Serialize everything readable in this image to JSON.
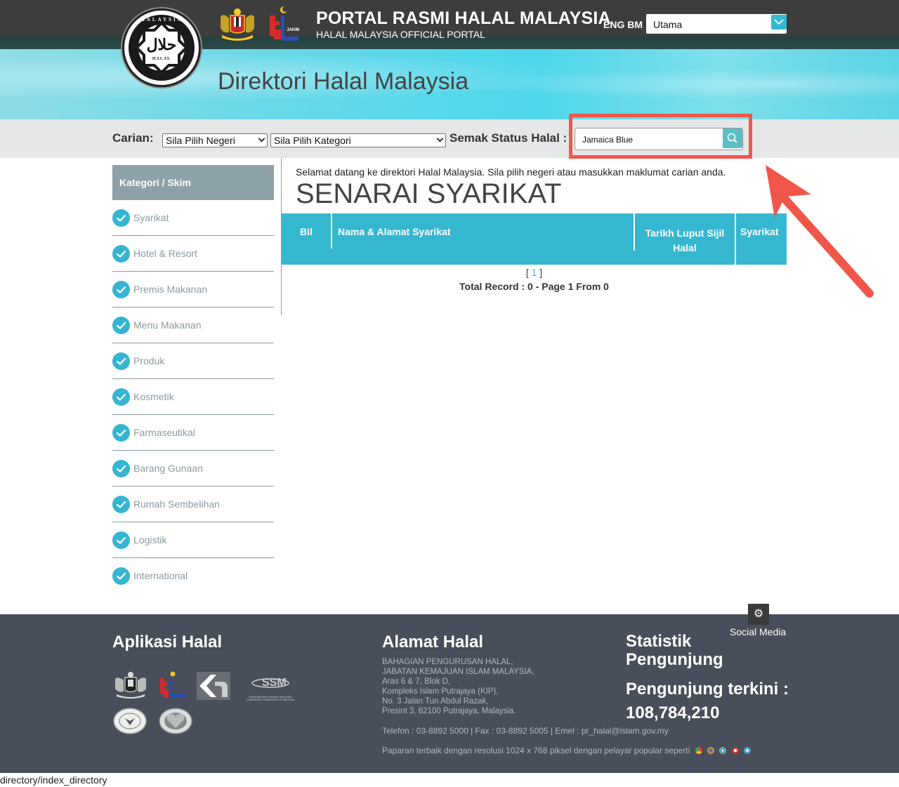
{
  "header": {
    "portal_title": "PORTAL RASMI HALAL MALAYSIA",
    "portal_subtitle": "HALAL MALAYSIA OFFICIAL PORTAL",
    "logo_ring_text": "MALAYSIA",
    "logo_halal_text": "HALAL",
    "logo_arabic_text": "حلال",
    "jakim_label": "JAKIM",
    "lang_eng": "ENG",
    "lang_bm": "BM",
    "nav_select_value": "Utama",
    "page_title": "Direktori Halal Malaysia"
  },
  "search": {
    "carian_label": "Carian:",
    "negeri_select": "Sila Pilih Negeri",
    "kategori_select": "Sila Pilih Kategori",
    "semak_label": "Semak Status Halal :",
    "search_value": "Jamaica Blue"
  },
  "sidebar": {
    "heading": "Kategori / Skim",
    "items": [
      {
        "label": "Syarikat"
      },
      {
        "label": "Hotel & Resort"
      },
      {
        "label": "Premis Makanan"
      },
      {
        "label": "Menu Makanan"
      },
      {
        "label": "Produk"
      },
      {
        "label": "Kosmetik"
      },
      {
        "label": "Farmaseutikal"
      },
      {
        "label": "Barang Gunaan"
      },
      {
        "label": "Rumah Sembelihan"
      },
      {
        "label": "Logistik"
      },
      {
        "label": "International"
      }
    ]
  },
  "main": {
    "welcome": "Selamat datang ke direktori Halal Malaysia. Sila pilih negeri atau masukkan maklumat carian anda.",
    "list_title": "SENARAI SYARIKAT",
    "columns": [
      "Bil",
      "Nama & Alamat Syarikat",
      "Tarikh Luput Sijil Halal",
      "Syarikat"
    ],
    "pager_open": "[ ",
    "pager_page": "1",
    "pager_close": " ]",
    "total": "Total Record : 0 - Page 1 From 0"
  },
  "footer": {
    "social_media": "Social Media",
    "aplikasi_heading": "Aplikasi Halal",
    "ssm_text": "SURUHANJAYA SYARIKAT MALAYSIA",
    "ssm_sub": "COMPANIES COMMISSION OF MALAYSIA",
    "alamat_heading": "Alamat Halal",
    "address_lines": [
      "BAHAGIAN PENGURUSAN HALAL,",
      "JABATAN KEMAJUAN ISLAM MALAYSIA,",
      "Aras 6 & 7, Blok D,",
      "Kompleks Islam Putrajaya (KIP),",
      "No. 3 Jalan Tun Abdul Razak,",
      "Presint 3, 62100 Putrajaya, Malaysia."
    ],
    "contact": "Telefon : 03-8892 5000 | Fax : 03-8892 5005 | Emel : pr_halal@islam.gov.my",
    "resolution_note": "Paparan terbaik dengan resolusi 1024 x 768 piksel dengan pelayar popular seperti",
    "statistik_line1": "Statistik",
    "statistik_line2": "Pengunjung",
    "visitors_label": "Pengunjung terkini :",
    "visitors_count": "108,784,210"
  },
  "status_bar": {
    "url": "directory/index_directory"
  },
  "colors": {
    "accent": "#36b7d0",
    "annotation": "#f0564a",
    "footer_bg": "#494f5a"
  }
}
